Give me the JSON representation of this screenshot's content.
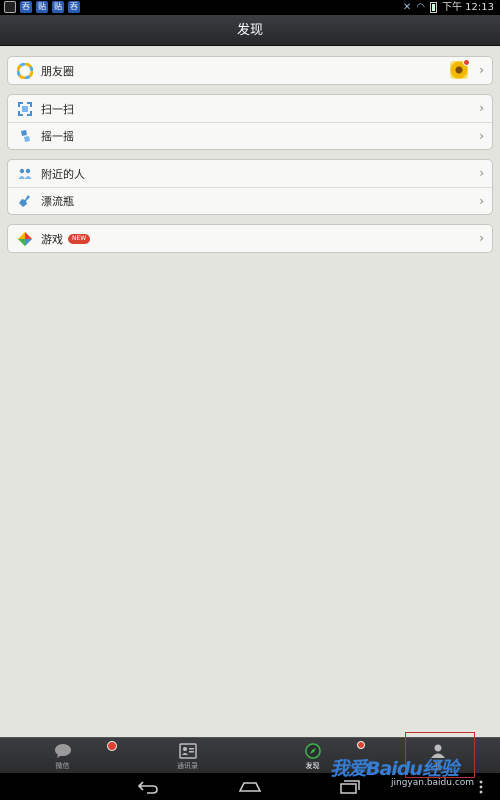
{
  "status_bar": {
    "app_icons": [
      "吞",
      "贴",
      "贴",
      "吞"
    ],
    "time": "下午 12:13"
  },
  "title_bar": {
    "title": "发现"
  },
  "groups": [
    {
      "items": [
        {
          "label": "朋友圈",
          "icon": "moments-icon"
        }
      ]
    },
    {
      "items": [
        {
          "label": "扫一扫",
          "icon": "scan-icon"
        },
        {
          "label": "摇一摇",
          "icon": "shake-icon"
        }
      ]
    },
    {
      "items": [
        {
          "label": "附近的人",
          "icon": "nearby-icon"
        },
        {
          "label": "漂流瓶",
          "icon": "bottle-icon"
        }
      ]
    },
    {
      "items": [
        {
          "label": "游戏",
          "icon": "game-icon",
          "badge": "NEW"
        }
      ]
    }
  ],
  "tab_bar": {
    "tabs": [
      {
        "label": "微信",
        "icon": "chat-icon"
      },
      {
        "label": "通讯录",
        "icon": "contacts-icon"
      },
      {
        "label": "发现",
        "icon": "compass-icon",
        "active": true
      },
      {
        "label": "我",
        "icon": "me-icon"
      }
    ]
  },
  "watermark": {
    "text": "我爱Baidu经验",
    "url": "jingyan.baidu.com"
  },
  "colors": {
    "accent": "#3db54a",
    "badge_red": "#d9432f",
    "titlebar": "#2f3134"
  }
}
